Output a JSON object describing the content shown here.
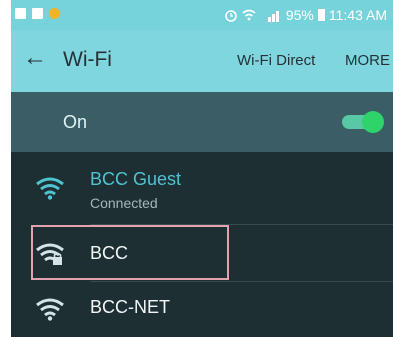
{
  "status_bar": {
    "alarm_icon": "alarm-icon",
    "battery": "95%",
    "time": "11:43 AM"
  },
  "toolbar": {
    "back_icon": "back-arrow-icon",
    "title": "Wi-Fi",
    "wifi_direct_label": "Wi-Fi Direct",
    "more_label": "MORE"
  },
  "master_switch": {
    "label": "On",
    "state": "on"
  },
  "networks": [
    {
      "name": "BCC Guest",
      "status": "Connected",
      "secured": false
    },
    {
      "name": "BCC",
      "status": "",
      "secured": true
    },
    {
      "name": "BCC-NET",
      "status": "",
      "secured": false
    }
  ],
  "colors": {
    "accent": "#4fc3d0",
    "toolbar_bg": "#7fd6df",
    "toggle": "#2ed46a",
    "highlight": "#e3a2ad"
  }
}
